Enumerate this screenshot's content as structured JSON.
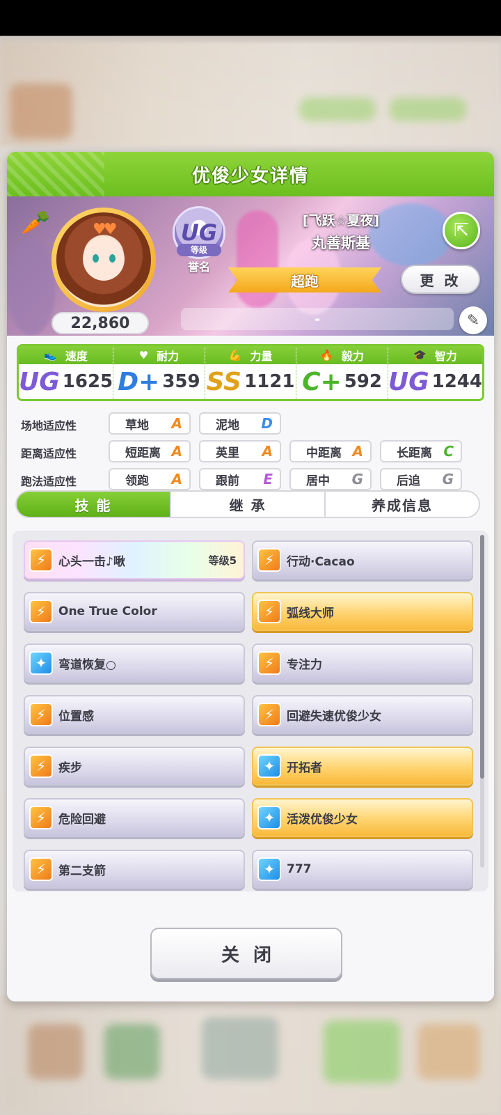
{
  "panel": {
    "title": "优俊少女详情"
  },
  "profile": {
    "score": "22,860",
    "rank_letter": "UG",
    "rank_label": "等级",
    "rank_name": "誉名",
    "horse_title": "[飞跃☆夏夜]",
    "horse_name": "丸善斯基",
    "style_label": "超跑",
    "change_label": "更 改",
    "trainer_text": "-",
    "colors": {
      "header_green": "#7cc832",
      "ribbon_gold": "#f4a81c"
    }
  },
  "stats": [
    {
      "label": "速度",
      "icon": "shoe-icon",
      "grade": "UG",
      "grade_color": "#7d5bd6",
      "value": "1625"
    },
    {
      "label": "耐力",
      "icon": "heart-icon",
      "grade": "D+",
      "grade_color": "#2f7de0",
      "value": "359"
    },
    {
      "label": "力量",
      "icon": "muscle-icon",
      "grade": "SS",
      "grade_color": "#e0a21a",
      "value": "1121"
    },
    {
      "label": "毅力",
      "icon": "flame-icon",
      "grade": "C+",
      "grade_color": "#4bb52a",
      "value": "592"
    },
    {
      "label": "智力",
      "icon": "cap-icon",
      "grade": "UG",
      "grade_color": "#7d5bd6",
      "value": "1244"
    }
  ],
  "aptitudes": {
    "field_label": "场地适应性",
    "distance_label": "距离适应性",
    "style_label": "跑法适应性",
    "field": [
      {
        "name": "草地",
        "grade": "A",
        "color": "#f08a1e"
      },
      {
        "name": "泥地",
        "grade": "D",
        "color": "#3b8de8"
      }
    ],
    "distance": [
      {
        "name": "短距离",
        "grade": "A",
        "color": "#f08a1e"
      },
      {
        "name": "英里",
        "grade": "A",
        "color": "#f08a1e"
      },
      {
        "name": "中距离",
        "grade": "A",
        "color": "#f08a1e"
      },
      {
        "name": "长距离",
        "grade": "C",
        "color": "#4bb52a"
      }
    ],
    "style": [
      {
        "name": "领跑",
        "grade": "A",
        "color": "#f08a1e"
      },
      {
        "name": "跟前",
        "grade": "E",
        "color": "#b25bd6"
      },
      {
        "name": "居中",
        "grade": "G",
        "color": "#8d8d96"
      },
      {
        "name": "后追",
        "grade": "G",
        "color": "#8d8d96"
      }
    ]
  },
  "tabs": [
    {
      "label": "技 能",
      "active": true
    },
    {
      "label": "继 承",
      "active": false
    },
    {
      "label": "养成信息",
      "active": false
    }
  ],
  "skills": [
    {
      "name": "心头一击♪啾",
      "level": "等级5",
      "style": "rainbow",
      "icon": "orange"
    },
    {
      "name": "行动·Cacao",
      "level": "",
      "style": "normal",
      "icon": "orange"
    },
    {
      "name": "One True Color",
      "level": "",
      "style": "normal",
      "icon": "orange"
    },
    {
      "name": "弧线大师",
      "level": "",
      "style": "gold",
      "icon": "orange"
    },
    {
      "name": "弯道恢复○",
      "level": "",
      "style": "normal",
      "icon": "blue"
    },
    {
      "name": "专注力",
      "level": "",
      "style": "normal",
      "icon": "orange"
    },
    {
      "name": "位置感",
      "level": "",
      "style": "normal",
      "icon": "orange"
    },
    {
      "name": "回避失速优俊少女",
      "level": "",
      "style": "normal",
      "icon": "orange"
    },
    {
      "name": "疾步",
      "level": "",
      "style": "normal",
      "icon": "orange"
    },
    {
      "name": "开拓者",
      "level": "",
      "style": "gold",
      "icon": "blue"
    },
    {
      "name": "危险回避",
      "level": "",
      "style": "normal",
      "icon": "orange"
    },
    {
      "name": "活泼优俊少女",
      "level": "",
      "style": "gold",
      "icon": "blue"
    },
    {
      "name": "第二支箭",
      "level": "",
      "style": "normal",
      "icon": "orange"
    },
    {
      "name": "777",
      "level": "",
      "style": "normal",
      "icon": "blue"
    }
  ],
  "close_label": "关闭"
}
